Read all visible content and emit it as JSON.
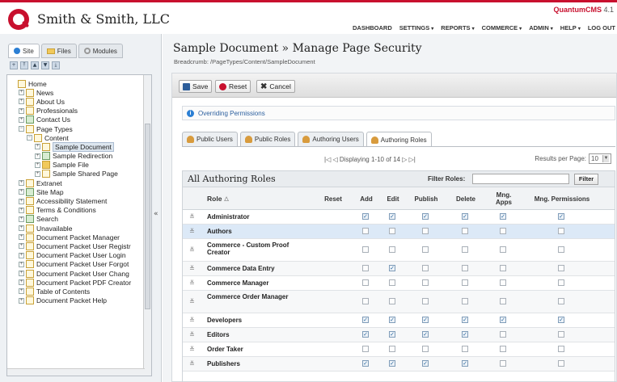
{
  "header": {
    "company": "Smith & Smith, LLC",
    "product_prefix": "Quantum",
    "product_suffix": "CMS",
    "product_version": "4.1",
    "nav": [
      {
        "label": "DASHBOARD",
        "dropdown": false
      },
      {
        "label": "SETTINGS",
        "dropdown": true
      },
      {
        "label": "REPORTS",
        "dropdown": true
      },
      {
        "label": "COMMERCE",
        "dropdown": true
      },
      {
        "label": "ADMIN",
        "dropdown": true
      },
      {
        "label": "HELP",
        "dropdown": true
      },
      {
        "label": "LOG OUT",
        "dropdown": false
      }
    ]
  },
  "sidebar": {
    "tabs": [
      {
        "label": "Site",
        "icon": "globe-icon",
        "active": true
      },
      {
        "label": "Files",
        "icon": "folder-icon",
        "active": false
      },
      {
        "label": "Modules",
        "icon": "gear-icon",
        "active": false
      }
    ],
    "collapse_glyph": "«",
    "tree": [
      {
        "label": "Home",
        "depth": 0,
        "exp": "",
        "icon": "page"
      },
      {
        "label": "News",
        "depth": 1,
        "exp": "+",
        "icon": "page"
      },
      {
        "label": "About Us",
        "depth": 1,
        "exp": "+",
        "icon": "page"
      },
      {
        "label": "Professionals",
        "depth": 1,
        "exp": "+",
        "icon": "page"
      },
      {
        "label": "Contact Us",
        "depth": 1,
        "exp": "+",
        "icon": "special"
      },
      {
        "label": "Page Types",
        "depth": 1,
        "exp": "-",
        "icon": "page"
      },
      {
        "label": "Content",
        "depth": 2,
        "exp": "-",
        "icon": "page"
      },
      {
        "label": "Sample Document",
        "depth": 3,
        "exp": "+",
        "icon": "page",
        "selected": true
      },
      {
        "label": "Sample Redirection",
        "depth": 3,
        "exp": "+",
        "icon": "special"
      },
      {
        "label": "Sample File",
        "depth": 3,
        "exp": "+",
        "icon": "file"
      },
      {
        "label": "Sample Shared Page",
        "depth": 3,
        "exp": "+",
        "icon": "page"
      },
      {
        "label": "Extranet",
        "depth": 1,
        "exp": "+",
        "icon": "page"
      },
      {
        "label": "Site Map",
        "depth": 1,
        "exp": "+",
        "icon": "special"
      },
      {
        "label": "Accessibility Statement",
        "depth": 1,
        "exp": "+",
        "icon": "page"
      },
      {
        "label": "Terms & Conditions",
        "depth": 1,
        "exp": "+",
        "icon": "page"
      },
      {
        "label": "Search",
        "depth": 1,
        "exp": "+",
        "icon": "special"
      },
      {
        "label": "Unavailable",
        "depth": 1,
        "exp": "+",
        "icon": "page"
      },
      {
        "label": "Document Packet Manager",
        "depth": 1,
        "exp": "+",
        "icon": "page"
      },
      {
        "label": "Document Packet User Registr",
        "depth": 1,
        "exp": "+",
        "icon": "page"
      },
      {
        "label": "Document Packet User Login",
        "depth": 1,
        "exp": "+",
        "icon": "page"
      },
      {
        "label": "Document Packet User Forgot",
        "depth": 1,
        "exp": "+",
        "icon": "page"
      },
      {
        "label": "Document Packet User Chang",
        "depth": 1,
        "exp": "+",
        "icon": "page"
      },
      {
        "label": "Document Packet PDF Creator",
        "depth": 1,
        "exp": "+",
        "icon": "page"
      },
      {
        "label": "Table of Contents",
        "depth": 1,
        "exp": "+",
        "icon": "page"
      },
      {
        "label": "Document Packet Help",
        "depth": 1,
        "exp": "+",
        "icon": "page"
      }
    ]
  },
  "main": {
    "title": "Sample Document » Manage Page Security",
    "breadcrumb": "Breadcrumb: /PageTypes/Content/SampleDocument",
    "toolbar": {
      "save": "Save",
      "reset": "Reset",
      "cancel": "Cancel"
    },
    "overriding": "Overriding Permissions",
    "tabs": [
      {
        "label": "Public Users",
        "active": false
      },
      {
        "label": "Public Roles",
        "active": false
      },
      {
        "label": "Authoring Users",
        "active": false
      },
      {
        "label": "Authoring Roles",
        "active": true
      }
    ],
    "pager": {
      "nav": "|◁ ◁  Displaying 1-10 of 14  ▷ ▷|",
      "results_label": "Results per Page:",
      "results_value": "10"
    },
    "grid": {
      "title": "All Authoring Roles",
      "filter_label": "Filter Roles:",
      "filter_value": "",
      "filter_button": "Filter",
      "columns": [
        "Role",
        "Reset",
        "Add",
        "Edit",
        "Publish",
        "Delete",
        "Mng. Apps",
        "Mng. Permissions"
      ],
      "rows": [
        {
          "name": "Administrator",
          "perms": [
            true,
            true,
            true,
            true,
            true,
            true
          ],
          "h": 18
        },
        {
          "name": "Authors",
          "perms": [
            false,
            false,
            false,
            false,
            false,
            false
          ],
          "h": 18,
          "highlight": true
        },
        {
          "name": "Commerce - Custom Proof Creator",
          "perms": [
            false,
            false,
            false,
            false,
            false,
            false
          ],
          "h": 28
        },
        {
          "name": "Commerce Data Entry",
          "perms": [
            false,
            true,
            false,
            false,
            false,
            false
          ],
          "h": 18
        },
        {
          "name": "Commerce Manager",
          "perms": [
            false,
            false,
            false,
            false,
            false,
            false
          ],
          "h": 18
        },
        {
          "name": "Commerce Order Manager",
          "perms": [
            false,
            false,
            false,
            false,
            false,
            false
          ],
          "h": 28
        },
        {
          "name": "Developers",
          "perms": [
            true,
            true,
            true,
            true,
            true,
            true
          ],
          "h": 18
        },
        {
          "name": "Editors",
          "perms": [
            true,
            true,
            true,
            true,
            false,
            false
          ],
          "h": 18
        },
        {
          "name": "Order Taker",
          "perms": [
            false,
            false,
            false,
            false,
            false,
            false
          ],
          "h": 18
        },
        {
          "name": "Publishers",
          "perms": [
            true,
            true,
            true,
            true,
            false,
            false
          ],
          "h": 18
        }
      ]
    }
  }
}
